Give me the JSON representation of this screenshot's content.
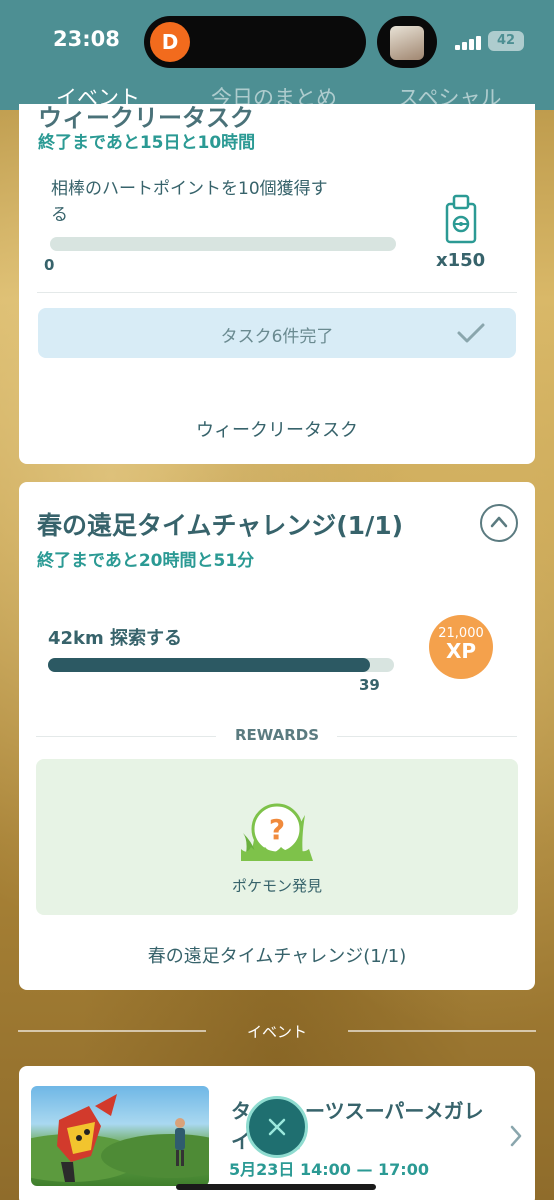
{
  "status": {
    "time": "23:08",
    "app_icon": "D",
    "battery": "42"
  },
  "tabs": [
    {
      "label": "イベント",
      "active": true
    },
    {
      "label": "今日のまとめ",
      "active": false
    },
    {
      "label": "スペシャル",
      "active": false
    }
  ],
  "weekly": {
    "title_partial": "ウィークリータスク",
    "remaining": "終了まであと15日と10時間",
    "task": "相棒のハートポイントを10個獲得する",
    "task_line1": "相棒のハートポイントを10個獲得す",
    "task_line2": "る",
    "progress_value": "0",
    "progress_fraction": 0,
    "reward_icon": "incubator-icon",
    "reward_count": "x150",
    "complete_label": "タスク6件完了",
    "footer_label": "ウィークリータスク"
  },
  "challenge": {
    "title": "春の遠足タイムチャレンジ(1/1)",
    "remaining": "終了まであと20時間と51分",
    "task": "42km 探索する",
    "progress_value": "39",
    "progress_fraction": 0.93,
    "xp_amount": "21,000",
    "xp_label": "XP",
    "rewards_header": "REWARDS",
    "reward_label": "ポケモン発見",
    "footer_label": "春の遠足タイムチャレンジ(1/1)"
  },
  "events_section": {
    "header": "イベント",
    "event_title": "ターボーツスーパーメガレイド",
    "event_title_line1": "タ",
    "event_title_line1b": "ーツスーパーメガレ",
    "event_title_line2": "イ",
    "event_title_line2b": "イ",
    "event_date": "5月23日 14:00 — 17:00"
  },
  "colors": {
    "teal": "#4d8f93",
    "accent": "#2b9a94",
    "gold": "#c7a24f",
    "xp": "#f4a14c"
  }
}
